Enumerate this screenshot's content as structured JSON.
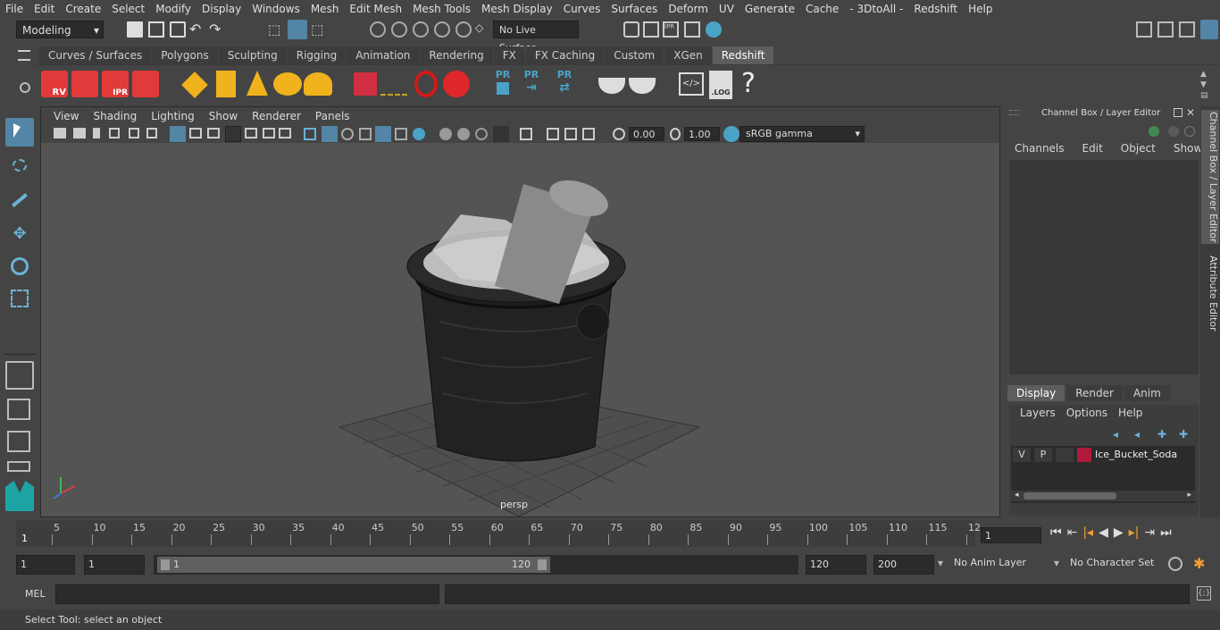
{
  "menubar": {
    "items": [
      "File",
      "Edit",
      "Create",
      "Select",
      "Modify",
      "Display",
      "Windows",
      "Mesh",
      "Edit Mesh",
      "Mesh Tools",
      "Mesh Display",
      "Curves",
      "Surfaces",
      "Deform",
      "UV",
      "Generate",
      "Cache",
      "- 3DtoAll -",
      "Redshift",
      "Help"
    ]
  },
  "statusline": {
    "mode": "Modeling",
    "live_surface": "No Live Surface"
  },
  "shelf": {
    "tabs": [
      "Curves / Surfaces",
      "Polygons",
      "Sculpting",
      "Rigging",
      "Animation",
      "Rendering",
      "FX",
      "FX Caching",
      "Custom",
      "XGen",
      "Redshift"
    ],
    "active_tab": "Redshift",
    "icon_labels": {
      "rv": "RV",
      "ipr": "IPR",
      "pr1": "PR",
      "pr2": "PR",
      "pr3": "PR",
      "log": ".LOG",
      "help": "?"
    }
  },
  "viewport": {
    "menu": [
      "View",
      "Shading",
      "Lighting",
      "Show",
      "Renderer",
      "Panels"
    ],
    "exposure": "0.00",
    "gamma": "1.00",
    "colorspace": "sRGB gamma",
    "camera_label": "persp"
  },
  "channel_box": {
    "title": "Channel Box / Layer Editor",
    "menu": [
      "Channels",
      "Edit",
      "Object",
      "Show"
    ],
    "layer_tabs": [
      "Display",
      "Render",
      "Anim"
    ],
    "layer_menu": [
      "Layers",
      "Options",
      "Help"
    ],
    "layer": {
      "v": "V",
      "p": "P",
      "name": "Ice_Bucket_Soda",
      "color": "#b01a3a"
    }
  },
  "side_tabs": [
    "Channel Box / Layer Editor",
    "Attribute Editor"
  ],
  "timeline": {
    "ticks": [
      "5",
      "10",
      "15",
      "20",
      "25",
      "30",
      "35",
      "40",
      "45",
      "50",
      "55",
      "60",
      "65",
      "70",
      "75",
      "80",
      "85",
      "90",
      "95",
      "100",
      "105",
      "110",
      "115",
      "12"
    ],
    "start_marker": "1",
    "current_frame": "1"
  },
  "range": {
    "start": "1",
    "playback_start": "1",
    "slider_start": "1",
    "slider_end": "120",
    "playback_end": "120",
    "end": "200",
    "anim_layer": "No Anim Layer",
    "character_set": "No Character Set"
  },
  "command": {
    "label": "MEL"
  },
  "help_line": "Select Tool: select an object",
  "colors": {
    "accent": "#5285a6",
    "redshift": "#e23a3a",
    "gold": "#f0b21d"
  }
}
